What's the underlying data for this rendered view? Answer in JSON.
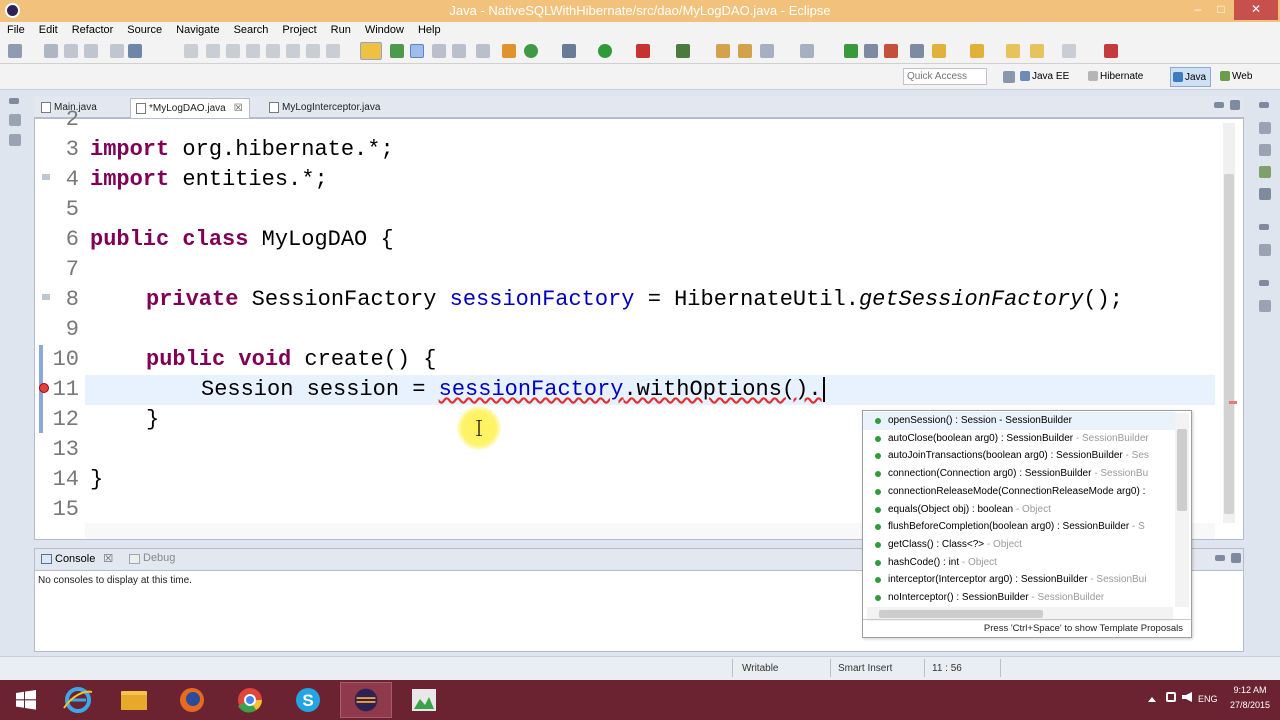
{
  "window": {
    "title": "Java - NativeSQLWithHibernate/src/dao/MyLogDAO.java - Eclipse",
    "minimize": "–",
    "maximize": "□",
    "close": "✕"
  },
  "menu": [
    "File",
    "Edit",
    "Refactor",
    "Source",
    "Navigate",
    "Search",
    "Project",
    "Run",
    "Window",
    "Help"
  ],
  "quick_access": {
    "placeholder": "Quick Access"
  },
  "perspectives": [
    {
      "label": "Java EE",
      "color": "#6c8bb8"
    },
    {
      "label": "Hibernate",
      "color": "#b5b5b5"
    },
    {
      "label": "Java",
      "color": "#3c7bc0",
      "active": true
    },
    {
      "label": "Web",
      "color": "#6b9e4a"
    }
  ],
  "editor_tabs": [
    {
      "label": "Main.java",
      "active": false
    },
    {
      "label": "*MyLogDAO.java",
      "active": true,
      "close": "☒"
    },
    {
      "label": "MyLogInterceptor.java",
      "active": false
    }
  ],
  "code": {
    "lines": [
      {
        "num": "2"
      },
      {
        "num": "3",
        "kw": "import",
        "text": " org.hibernate.*;"
      },
      {
        "num": "4",
        "kw": "import",
        "text": " entities.*;"
      },
      {
        "num": "5"
      },
      {
        "num": "6",
        "kw": "public class",
        "text": " MyLogDAO {"
      },
      {
        "num": "7"
      },
      {
        "num": "8",
        "kw": "private",
        "type": " SessionFactory ",
        "field": "sessionFactory",
        "rest": " = HibernateUtil.",
        "method": "getSessionFactory",
        "end": "();"
      },
      {
        "num": "9"
      },
      {
        "num": "10",
        "kw": "public void",
        "text": " create() {"
      },
      {
        "num": "11",
        "text": "Session session = ",
        "field_u": "sessionFactory",
        "rest": ".withOptions()."
      },
      {
        "num": "12",
        "text": "}"
      },
      {
        "num": "13"
      },
      {
        "num": "14",
        "text": "}"
      },
      {
        "num": "15"
      }
    ]
  },
  "completion": {
    "proposals": [
      {
        "sig": "openSession() : Session - SessionBuilder",
        "owner": ""
      },
      {
        "sig": "autoClose(boolean arg0) : SessionBuilder",
        "owner": " - SessionBuilder"
      },
      {
        "sig": "autoJoinTransactions(boolean arg0) : SessionBuilder",
        "owner": " - Ses"
      },
      {
        "sig": "connection(Connection arg0) : SessionBuilder",
        "owner": " - SessionBu"
      },
      {
        "sig": "connectionReleaseMode(ConnectionReleaseMode arg0) :",
        "owner": ""
      },
      {
        "sig": "equals(Object obj) : boolean",
        "owner": " - Object"
      },
      {
        "sig": "flushBeforeCompletion(boolean arg0) : SessionBuilder",
        "owner": " - S"
      },
      {
        "sig": "getClass() : Class<?>",
        "owner": " - Object"
      },
      {
        "sig": "hashCode() : int",
        "owner": " - Object"
      },
      {
        "sig": "interceptor(Interceptor arg0) : SessionBuilder",
        "owner": " - SessionBui"
      },
      {
        "sig": "noInterceptor() : SessionBuilder",
        "owner": " - SessionBuilder"
      }
    ],
    "hint": "Press 'Ctrl+Space' to show Template Proposals"
  },
  "console": {
    "tabs": [
      "Console",
      "Debug"
    ],
    "message": "No consoles to display at this time."
  },
  "status": {
    "writable": "Writable",
    "insert_mode": "Smart Insert",
    "position": "11 : 56"
  },
  "taskbar": {
    "language": "ENG",
    "time": "9:12 AM",
    "date": "27/8/2015"
  },
  "colors": {
    "keyword": "#7f0055",
    "field": "#0000c0",
    "titlebar": "#f2c27c",
    "taskbar": "#6b2332"
  }
}
